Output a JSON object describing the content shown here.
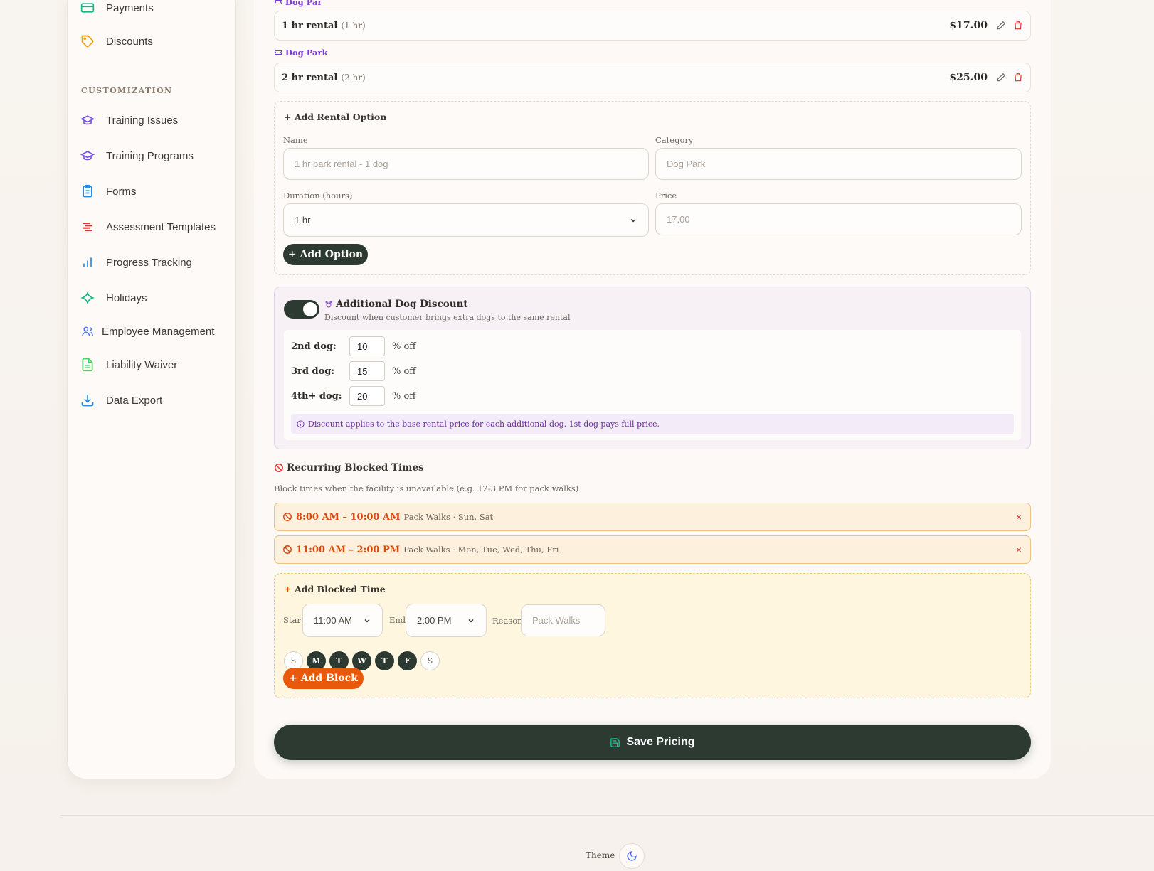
{
  "sidebar": {
    "items_top": [
      {
        "label": "Payments",
        "icon": "credit-card-icon"
      },
      {
        "label": "Discounts",
        "icon": "tag-icon"
      }
    ],
    "section_label": "CUSTOMIZATION",
    "items": [
      {
        "label": "Training Issues",
        "icon": "graduation-cap-icon"
      },
      {
        "label": "Training Programs",
        "icon": "graduation-cap-icon"
      },
      {
        "label": "Forms",
        "icon": "clipboard-icon"
      },
      {
        "label": "Assessment Templates",
        "icon": "list-icon"
      },
      {
        "label": "Progress Tracking",
        "icon": "bar-chart-icon"
      },
      {
        "label": "Holidays",
        "icon": "sparkle-icon"
      },
      {
        "label": "Employee Management",
        "icon": "users-icon"
      },
      {
        "label": "Liability Waiver",
        "icon": "file-icon"
      },
      {
        "label": "Data Export",
        "icon": "download-icon"
      }
    ]
  },
  "rentals": [
    {
      "category": "Dog Par",
      "name": "1 hr rental",
      "duration": "(1 hr)",
      "price": "$17.00"
    },
    {
      "category": "Dog Park",
      "name": "2 hr rental",
      "duration": "(2 hr)",
      "price": "$25.00"
    }
  ],
  "add_rental": {
    "title": "+ Add Rental Option",
    "name_label": "Name",
    "name_placeholder": "1 hr park rental - 1 dog",
    "category_label": "Category",
    "category_placeholder": "Dog Park",
    "duration_label": "Duration (hours)",
    "duration_value": "1 hr",
    "price_label": "Price",
    "price_placeholder": "17.00",
    "button": "+ Add Option"
  },
  "discount": {
    "enabled": true,
    "title": "Additional Dog Discount",
    "subtitle": "Discount when customer brings extra dogs to the same rental",
    "rows": [
      {
        "label": "2nd dog:",
        "value": "10",
        "suffix": "% off"
      },
      {
        "label": "3rd dog:",
        "value": "15",
        "suffix": "% off"
      },
      {
        "label": "4th+ dog:",
        "value": "20",
        "suffix": "% off"
      }
    ],
    "note": "Discount applies to the base rental price for each additional dog. 1st dog pays full price."
  },
  "blocked": {
    "title": "Recurring Blocked Times",
    "subtitle": "Block times when the facility is unavailable (e.g. 12-3 PM for pack walks)",
    "items": [
      {
        "time": "8:00 AM – 10:00 AM",
        "reason": "Pack Walks · Sun, Sat"
      },
      {
        "time": "11:00 AM – 2:00 PM",
        "reason": "Pack Walks · Mon, Tue, Wed, Thu, Fri"
      }
    ],
    "remove_glyph": "×"
  },
  "add_block": {
    "title": "Add Blocked Time",
    "start_label": "Start",
    "start_value": "11:00 AM",
    "end_label": "End",
    "end_value": "2:00 PM",
    "reason_label": "Reason",
    "reason_placeholder": "Pack Walks",
    "days": [
      {
        "letter": "S",
        "selected": false
      },
      {
        "letter": "M",
        "selected": true
      },
      {
        "letter": "T",
        "selected": true
      },
      {
        "letter": "W",
        "selected": true
      },
      {
        "letter": "T",
        "selected": true
      },
      {
        "letter": "F",
        "selected": true
      },
      {
        "letter": "S",
        "selected": false
      }
    ],
    "button": "+ Add Block"
  },
  "save_label": "Save Pricing",
  "theme_label": "Theme",
  "colors": {
    "accent_dark": "#2d3a31",
    "orange": "#e8590c",
    "purple": "#7a3fd1",
    "danger": "#e03131"
  }
}
